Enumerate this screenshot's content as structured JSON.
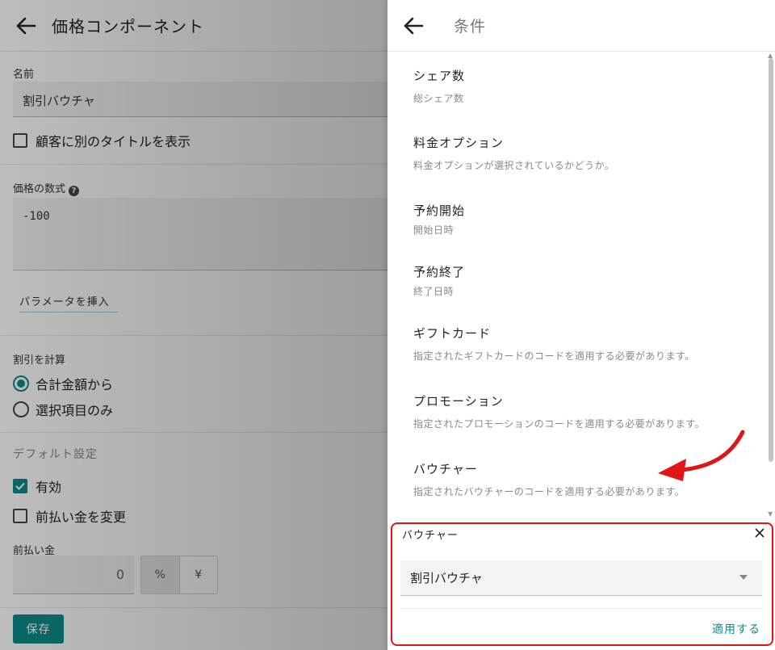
{
  "left_page": {
    "title": "価格コンポーネント",
    "name_label": "名前",
    "name_value": "割引バウチャ",
    "show_other_title_label": "顧客に別のタイトルを表示",
    "show_other_title_checked": false,
    "formula_label": "価格の数式",
    "formula_value": "-100",
    "insert_param_label": "パラメータを挿入",
    "discount_calc_label": "割引を計算",
    "discount_options": [
      {
        "label": "合計金額から",
        "selected": true
      },
      {
        "label": "選択項目のみ",
        "selected": false
      }
    ],
    "default_settings_label": "デフォルト設定",
    "enabled_label": "有効",
    "enabled_checked": true,
    "change_prepay_label": "前払い金を変更",
    "change_prepay_checked": false,
    "prepay_label": "前払い金",
    "prepay_value": "0",
    "unit_options": [
      "%",
      "¥"
    ],
    "unit_selected": "%",
    "save_label": "保存"
  },
  "drawer": {
    "title": "条件",
    "conditions": [
      {
        "title": "シェア数",
        "desc": "総シェア数"
      },
      {
        "title": "料金オプション",
        "desc": "料金オプションが選択されているかどうか。"
      },
      {
        "title": "予約開始",
        "desc": "開始日時"
      },
      {
        "title": "予約終了",
        "desc": "終了日時"
      },
      {
        "title": "ギフトカード",
        "desc": "指定されたギフトカードのコードを適用する必要があります。"
      },
      {
        "title": "プロモーション",
        "desc": "指定されたプロモーションのコードを適用する必要があります。"
      },
      {
        "title": "バウチャー",
        "desc": "指定されたバウチャーのコードを適用する必要があります。"
      }
    ],
    "voucher_panel": {
      "label": "バウチャー",
      "selected_value": "割引バウチャ",
      "apply_label": "適用する"
    }
  },
  "colors": {
    "accent": "#0e8b8b",
    "highlight": "#e01515"
  }
}
